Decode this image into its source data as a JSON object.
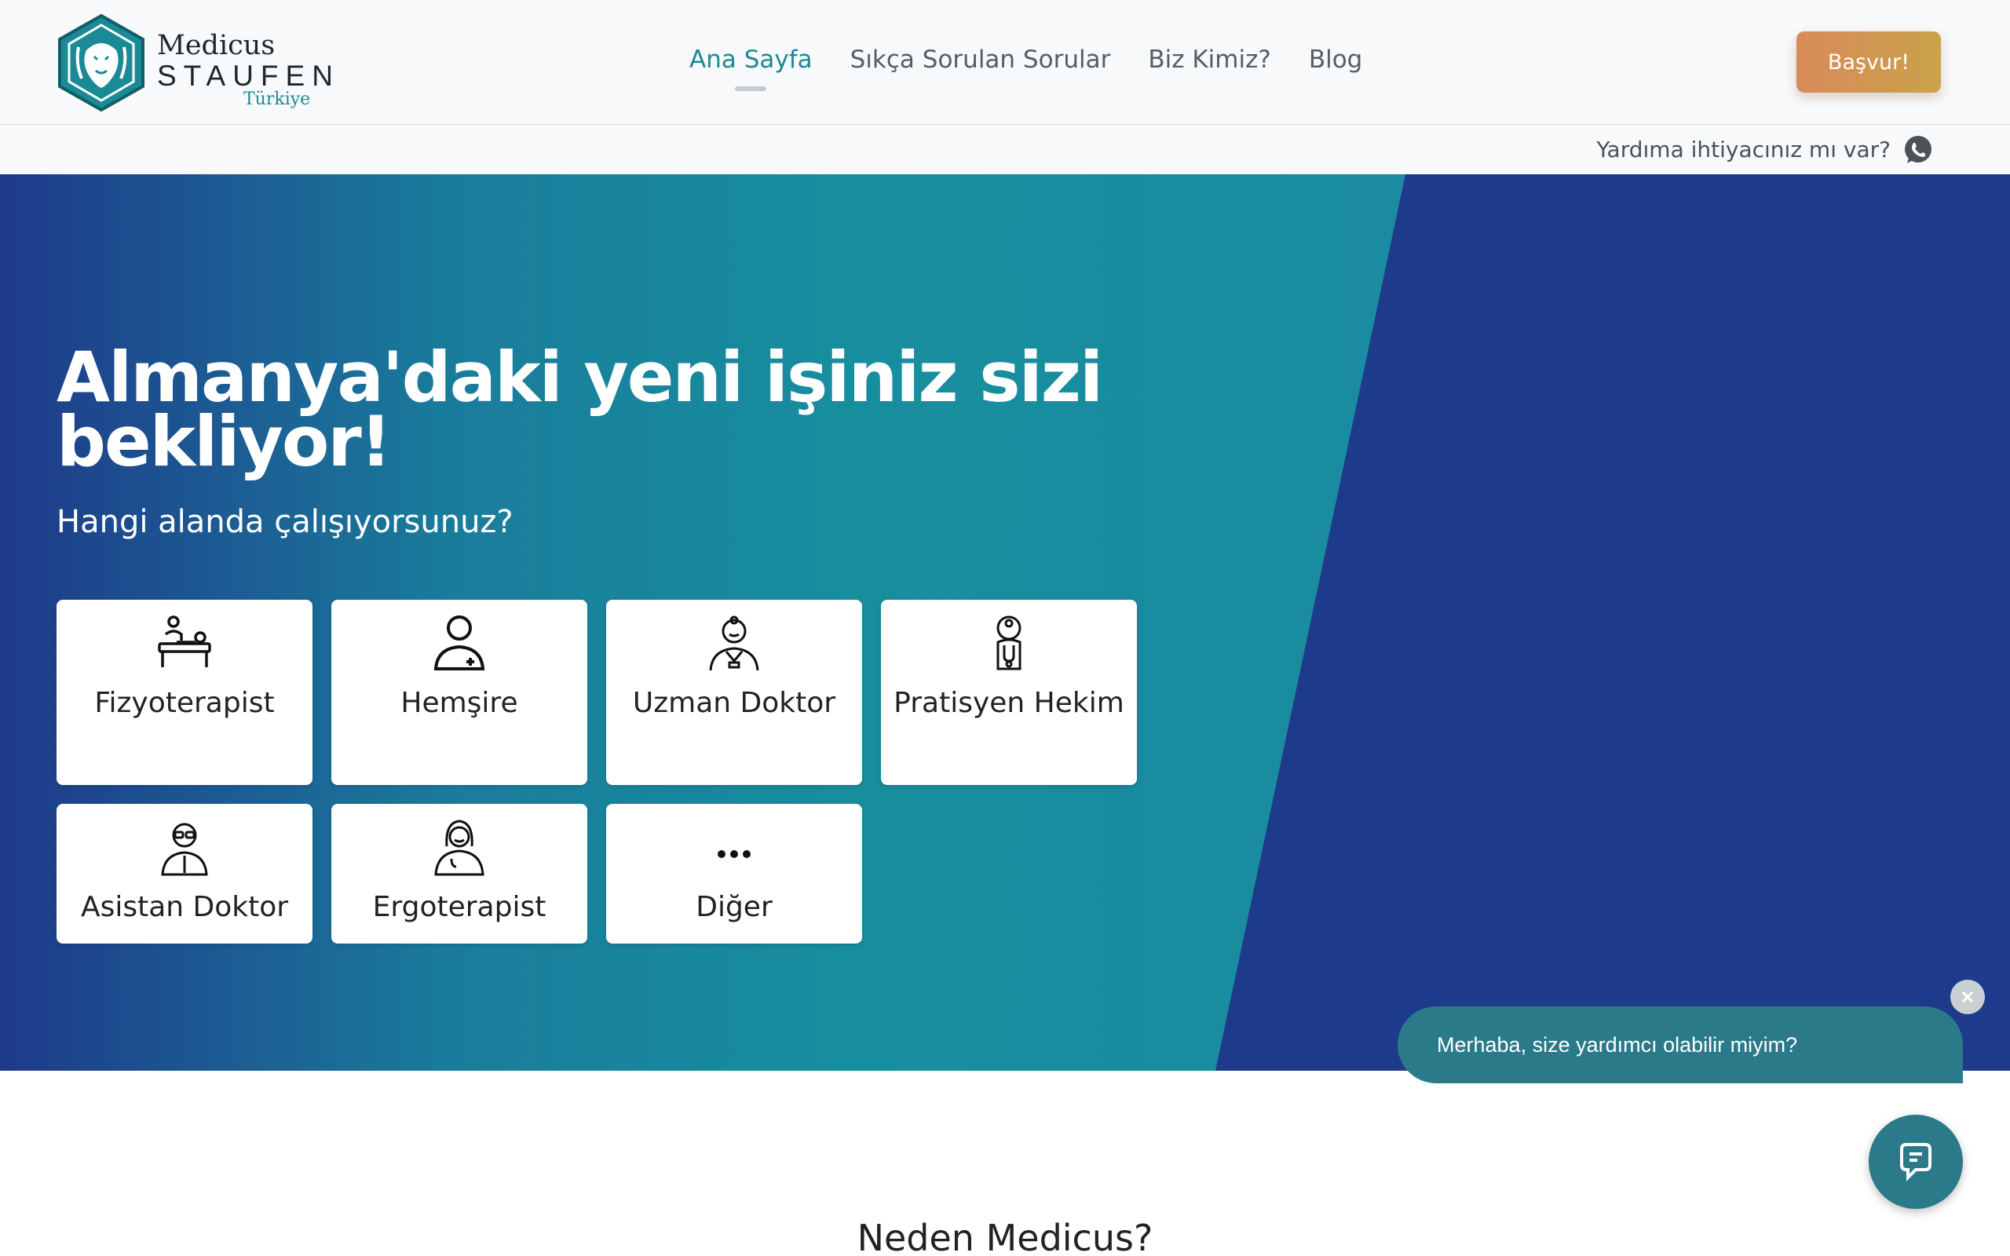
{
  "brand": {
    "line1": "Medicus",
    "line2": "STAUFEN",
    "line3": "Türkiye",
    "logo_icon": "lion-shield-icon",
    "accent_color": "#1a8a96"
  },
  "nav": {
    "items": [
      {
        "label": "Ana Sayfa",
        "active": true
      },
      {
        "label": "Sıkça Sorulan Sorular",
        "active": false
      },
      {
        "label": "Biz Kimiz?",
        "active": false
      },
      {
        "label": "Blog",
        "active": false
      }
    ],
    "apply_label": "Başvur!"
  },
  "helpbar": {
    "text": "Yardıma ihtiyacınız mı var?",
    "icon": "whatsapp-icon"
  },
  "hero": {
    "title": "Almanya'daki yeni işiniz sizi bekliyor!",
    "subtitle": "Hangi alanda çalışıyorsunuz?",
    "colors": {
      "teal": "#1a8a9a",
      "navy": "#1e3a8a"
    },
    "professions": [
      {
        "label": "Fizyoterapist",
        "icon": "physiotherapist-icon"
      },
      {
        "label": "Hemşire",
        "icon": "nurse-icon"
      },
      {
        "label": "Uzman Doktor",
        "icon": "specialist-doctor-icon"
      },
      {
        "label": "Pratisyen Hekim",
        "icon": "general-practitioner-icon"
      },
      {
        "label": "Asistan Doktor",
        "icon": "assistant-doctor-icon"
      },
      {
        "label": "Ergoterapist",
        "icon": "occupational-therapist-icon"
      },
      {
        "label": "Diğer",
        "icon": "more-dots-icon"
      }
    ]
  },
  "section": {
    "title": "Neden Medicus?"
  },
  "chat": {
    "message": "Merhaba, size yardımcı olabilir miyim?",
    "close_icon": "close-icon",
    "fab_icon": "chat-icon"
  }
}
